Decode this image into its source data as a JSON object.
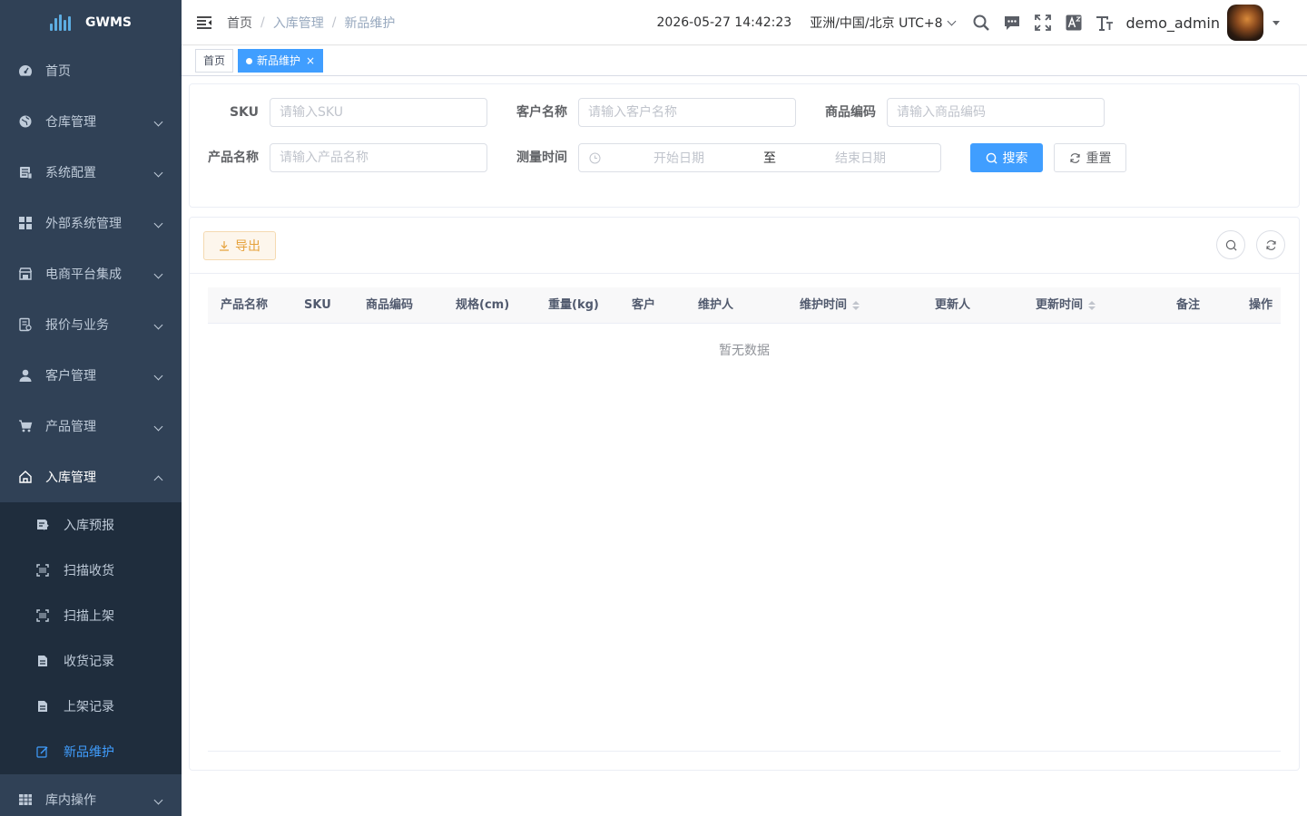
{
  "app": {
    "name": "GWMS"
  },
  "sidebar": {
    "items": [
      {
        "label": "首页",
        "icon": "dashboard-icon"
      },
      {
        "label": "仓库管理",
        "icon": "globe-icon"
      },
      {
        "label": "系统配置",
        "icon": "server-icon"
      },
      {
        "label": "外部系统管理",
        "icon": "grid-icon"
      },
      {
        "label": "电商平台集成",
        "icon": "store-icon"
      },
      {
        "label": "报价与业务",
        "icon": "document-icon"
      },
      {
        "label": "客户管理",
        "icon": "user-icon"
      },
      {
        "label": "产品管理",
        "icon": "cart-icon"
      },
      {
        "label": "入库管理",
        "icon": "home-icon"
      },
      {
        "label": "库内操作",
        "icon": "table-icon"
      }
    ],
    "submenu": [
      {
        "label": "入库预报",
        "icon": "edit-doc-icon"
      },
      {
        "label": "扫描收货",
        "icon": "scan-icon"
      },
      {
        "label": "扫描上架",
        "icon": "scan-icon"
      },
      {
        "label": "收货记录",
        "icon": "file-icon"
      },
      {
        "label": "上架记录",
        "icon": "file-icon"
      },
      {
        "label": "新品维护",
        "icon": "edit-icon"
      }
    ]
  },
  "navbar": {
    "breadcrumb": [
      "首页",
      "入库管理",
      "新品维护"
    ],
    "datetime": "2026-05-27 14:42:23",
    "timezone": "亚洲/中国/北京 UTC+8",
    "username": "demo_admin"
  },
  "tags": {
    "home": "首页",
    "current": "新品维护"
  },
  "search": {
    "sku_label": "SKU",
    "sku_placeholder": "请输入SKU",
    "customer_label": "客户名称",
    "customer_placeholder": "请输入客户名称",
    "code_label": "商品编码",
    "code_placeholder": "请输入商品编码",
    "product_label": "产品名称",
    "product_placeholder": "请输入产品名称",
    "time_label": "测量时间",
    "start_placeholder": "开始日期",
    "range_sep": "至",
    "end_placeholder": "结束日期",
    "search_button": "搜索",
    "reset_button": "重置"
  },
  "toolbar": {
    "export_button": "导出"
  },
  "table": {
    "columns": [
      "产品名称",
      "SKU",
      "商品编码",
      "规格(cm)",
      "重量(kg)",
      "客户",
      "维护人",
      "维护时间",
      "更新人",
      "更新时间",
      "备注",
      "操作"
    ],
    "empty_text": "暂无数据"
  },
  "colors": {
    "sidebar_bg": "#304156",
    "submenu_bg": "#1f2d3d",
    "primary": "#409eff",
    "warning": "#e6a23c"
  }
}
